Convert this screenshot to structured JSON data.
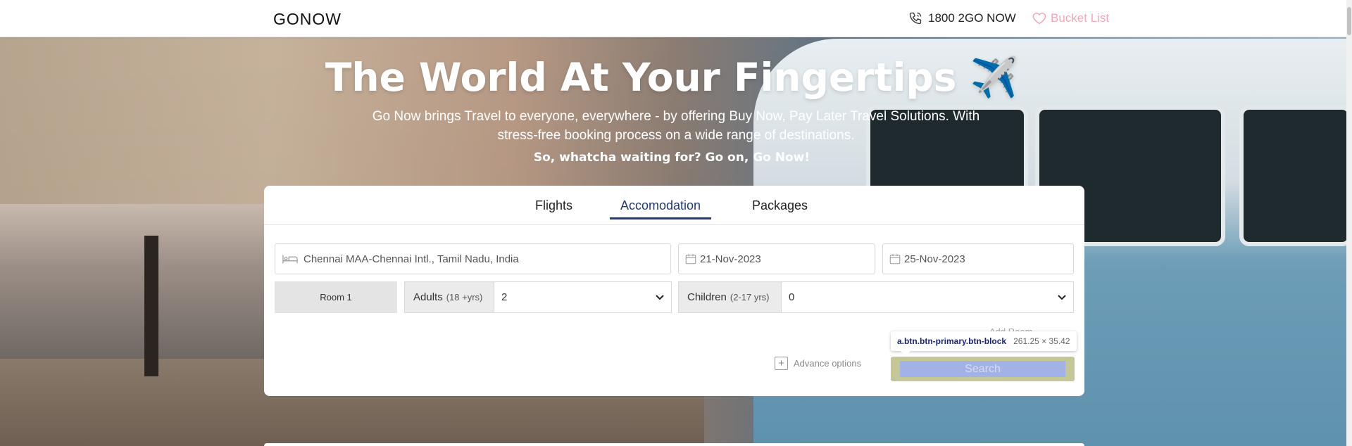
{
  "header": {
    "logo": "GONOW",
    "phone": "1800 2GO NOW",
    "bucket_list": "Bucket List"
  },
  "hero": {
    "title": "The World At Your Fingertips ✈️",
    "subtitle": "Go Now brings Travel to everyone, everywhere - by offering Buy Now, Pay Later Travel Solutions. With stress-free booking process on a wide range of destinations.",
    "cta": "So, whatcha waiting for? Go on, Go Now!"
  },
  "search": {
    "tabs": [
      {
        "label": "Flights",
        "active": false
      },
      {
        "label": "Accomodation",
        "active": true
      },
      {
        "label": "Packages",
        "active": false
      }
    ],
    "destination": "Chennai MAA-Chennai Intl., Tamil Nadu, India",
    "checkin": "21-Nov-2023",
    "checkout": "25-Nov-2023",
    "room_label": "Room 1",
    "adults_label": "Adults",
    "adults_hint": "(18 +yrs)",
    "adults_value": "2",
    "children_label": "Children",
    "children_hint": "(2-17 yrs)",
    "children_value": "0",
    "add_room": "Add Room",
    "advance_options": "Advance options",
    "search_button": "Search"
  },
  "devtools_tooltip": {
    "selector": "a.btn.btn-primary.btn-block",
    "dimensions": "261.25 × 35.42"
  },
  "colors": {
    "accent": "#1e3b76",
    "bucket": "#f3a7b9",
    "highlight_margin": "#c6c796",
    "highlight_content": "#a3b2e6"
  }
}
